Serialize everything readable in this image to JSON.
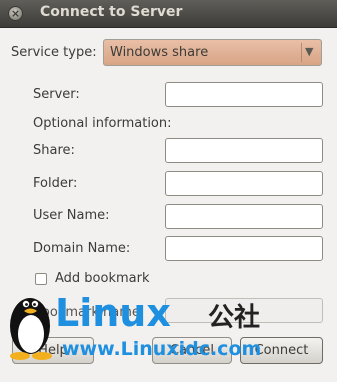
{
  "window": {
    "title": "Connect to Server",
    "close_glyph": "×"
  },
  "form": {
    "service_type_label": "Service type:",
    "service_type_value": "Windows share",
    "dropdown_arrow": "▼",
    "server_label": "Server:",
    "server_value": "",
    "optional_heading": "Optional information:",
    "share_label": "Share:",
    "share_value": "",
    "folder_label": "Folder:",
    "folder_value": "",
    "username_label": "User Name:",
    "username_value": "",
    "domain_label": "Domain Name:",
    "domain_value": "",
    "add_bookmark_label": "Add bookmark",
    "add_bookmark_checked": false,
    "bookmark_name_label": "Bookmark name:",
    "bookmark_name_value": ""
  },
  "buttons": {
    "help": "Help",
    "cancel": "Cancel",
    "connect": "Connect"
  },
  "watermark": {
    "logo_word": "Linux",
    "logo_cn": "公社",
    "url": "www.Linuxidc.com",
    "mascot": "tux-penguin-icon",
    "colors": {
      "blue": "#1f8fe0",
      "cn": "#222222"
    }
  },
  "colors": {
    "titlebar": "#3d3c38",
    "dropdown_bg": "#dfae92",
    "window_bg": "#f2f1f0"
  }
}
